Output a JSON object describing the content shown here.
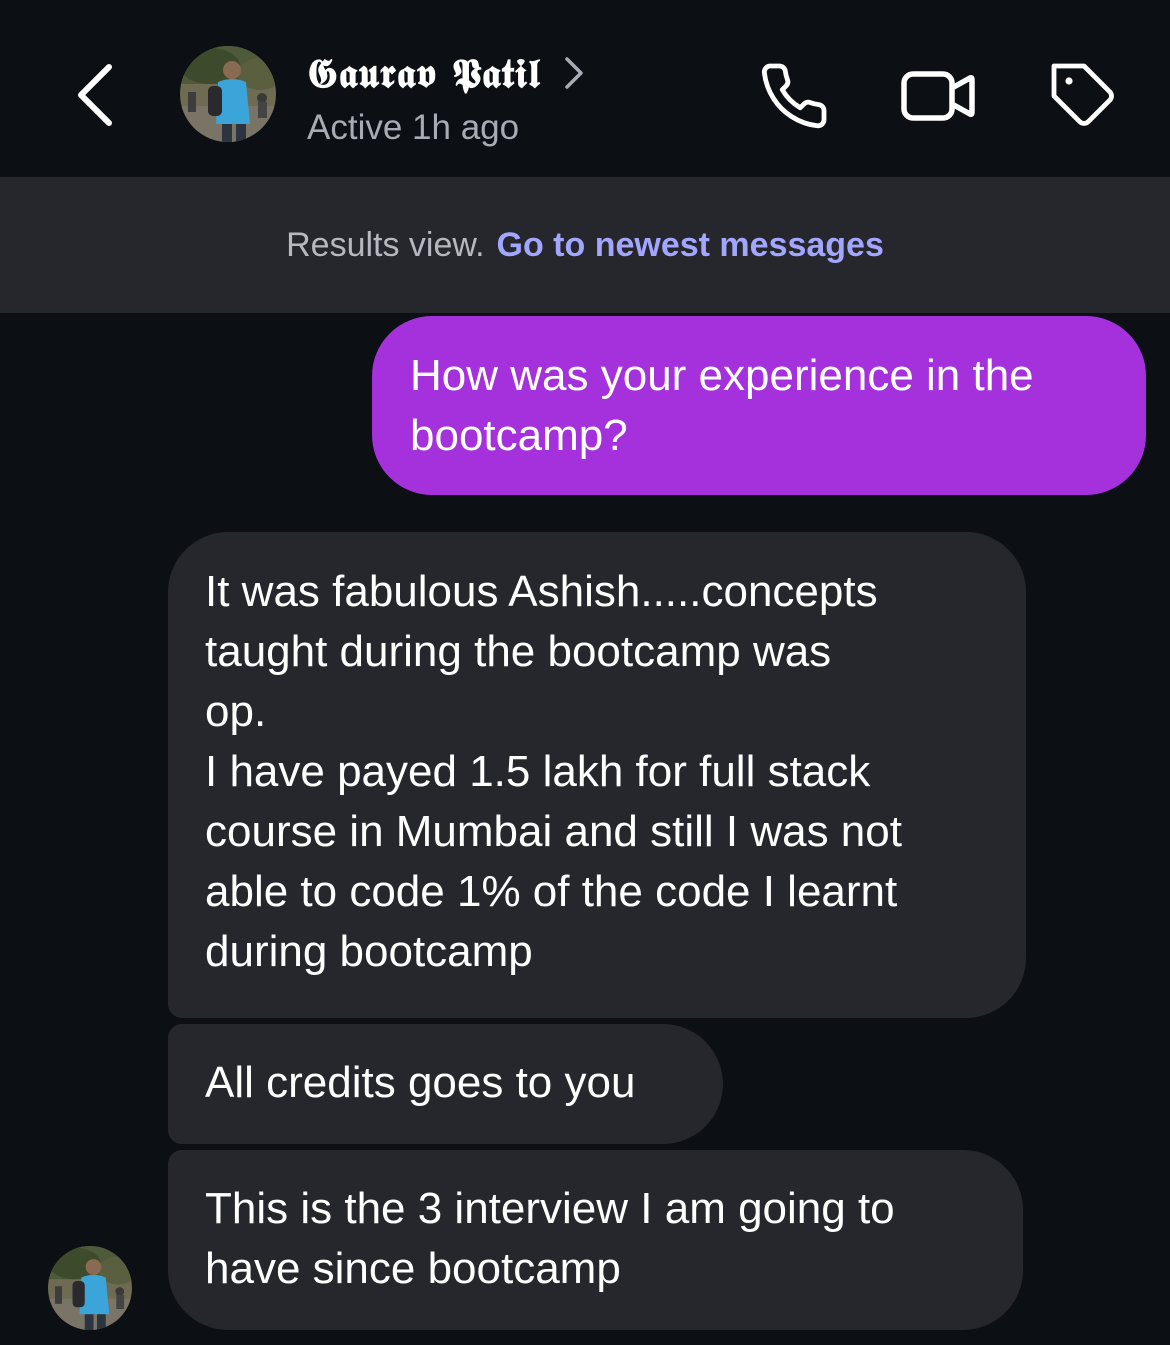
{
  "header": {
    "back_icon": "chevron-left-icon",
    "contact_name": "𝕲𝖆𝖚𝖗𝖆𝖛 𝕻𝖆𝖙𝖎𝖑",
    "contact_status": "Active 1h ago",
    "avatar_icon": "profile-photo",
    "actions": {
      "call_icon": "phone-icon",
      "video_icon": "video-camera-icon",
      "tag_icon": "tag-icon"
    }
  },
  "banner": {
    "text": "Results view.",
    "link": "Go to newest messages"
  },
  "messages": [
    {
      "direction": "outgoing",
      "lines": [
        "How was your experience in the",
        "bootcamp?"
      ]
    },
    {
      "direction": "incoming",
      "lines": [
        "It was fabulous Ashish.....concepts",
        "taught during the bootcamp was",
        "op.",
        "I have payed 1.5 lakh for full stack",
        "course in Mumbai and still I was not",
        "able to code 1% of the code I learnt",
        "during bootcamp"
      ]
    },
    {
      "direction": "incoming",
      "lines": [
        "All credits goes to you"
      ]
    },
    {
      "direction": "incoming",
      "lines": [
        "This is the 3 interview I am going to",
        "have since bootcamp"
      ]
    }
  ],
  "colors": {
    "background": "#0c0f14",
    "banner_bg": "#25272c",
    "outgoing_bubble": "#a431dc",
    "incoming_bubble": "#25272c",
    "link": "#a3a6ff",
    "secondary_text": "#a7abb3"
  }
}
